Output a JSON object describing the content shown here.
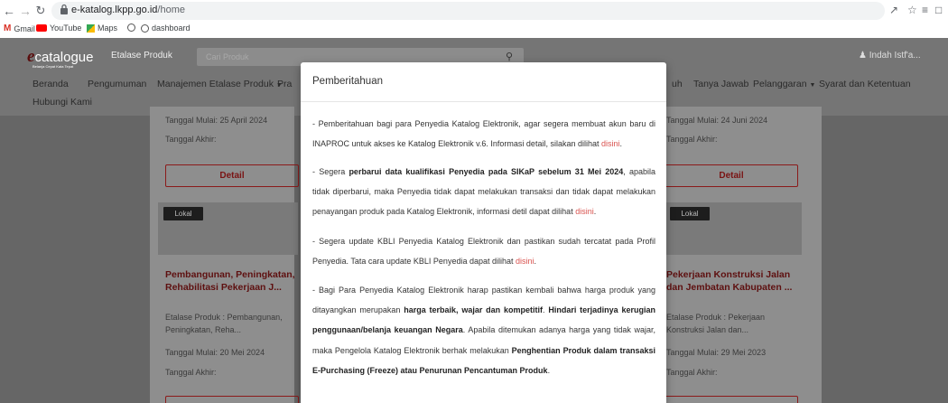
{
  "browser": {
    "url_domain": "e-katalog.lkpp.go.id",
    "url_path": "/home",
    "bookmarks": [
      {
        "label": "Gmail",
        "icon": "gmail-icon"
      },
      {
        "label": "YouTube",
        "icon": "youtube-icon"
      },
      {
        "label": "Maps",
        "icon": "maps-icon"
      },
      {
        "label": "",
        "icon": "globe-icon"
      },
      {
        "label": "dashboard",
        "icon": "globe-icon"
      }
    ]
  },
  "site": {
    "logo_text": "catalogue",
    "logo_sub": "Belanja Cepat Kata Tepat",
    "etalase": "Etalase Produk",
    "search_placeholder": "Cari Produk",
    "user": "Indah Istf'a...",
    "nav": {
      "beranda": "Beranda",
      "pengumuman": "Pengumuman",
      "manajemen": "Manajemen Etalase Produk",
      "prak": "Pra",
      "uh": "uh",
      "tanya": "Tanya Jawab",
      "pelanggaran": "Pelanggaran",
      "syarat": "Syarat dan Ketentuan",
      "hubungi": "Hubungi Kami"
    }
  },
  "cards": {
    "left": {
      "mulai_top": "Tanggal Mulai: 25 April 2024",
      "akhir_top": "Tanggal Akhir:",
      "detail": "Detail",
      "badge": "Lokal",
      "title": "Pembangunan, Peningkatan, Rehabilitasi Pekerjaan J...",
      "etalase": "Etalase Produk : Pembangunan, Peningkatan, Reha...",
      "mulai": "Tanggal Mulai: 20 Mei 2024",
      "akhir": "Tanggal Akhir:"
    },
    "right": {
      "mulai_top": "Tanggal Mulai: 24 Juni 2024",
      "akhir_top": "Tanggal Akhir:",
      "detail": "Detail",
      "badge": "Lokal",
      "title": "Pekerjaan Konstruksi Jalan dan Jembatan Kabupaten ...",
      "etalase": "Etalase Produk : Pekerjaan Konstruksi Jalan dan...",
      "mulai": "Tanggal Mulai: 29 Mei 2023",
      "akhir": "Tanggal Akhir:"
    }
  },
  "modal": {
    "title": "Pemberitahuan",
    "p1a": "- Pemberitahuan bagi para Penyedia Katalog Elektronik, agar segera membuat akun baru di INAPROC untuk akses ke Katalog Elektronik v.6. Informasi detail, silakan dilihat ",
    "p1link": "disini",
    "p2a": "- Segera ",
    "p2b": "perbarui data kualifikasi Penyedia pada SIKaP sebelum 31 Mei 2024",
    "p2c": ", apabila tidak diperbarui, maka Penyedia tidak dapat melakukan transaksi dan tidak dapat melakukan penayangan produk pada Katalog Elektronik, informasi detil dapat dilihat ",
    "p2link": "disini",
    "p3a": "- Segera update KBLI Penyedia Katalog Elektronik dan pastikan sudah tercatat pada Profil Penyedia. Tata cara update KBLI Penyedia dapat dilihat ",
    "p3link": "disini",
    "p4a": "- Bagi Para Penyedia Katalog Elektronik harap pastikan kembali bahwa harga produk yang ditayangkan merupakan ",
    "p4b": "harga terbaik, wajar dan kompetitif",
    "p4c": ". ",
    "p4d": "Hindari terjadinya kerugian penggunaan/belanja keuangan Negara",
    "p4e": ". Apabila ditemukan adanya harga yang tidak wajar, maka Pengelola Katalog Elektronik berhak melakukan ",
    "p4f": "Penghentian Produk dalam transaksi E-Purchasing (Freeze) atau Penurunan Pencantuman Produk",
    "p4g": "."
  }
}
